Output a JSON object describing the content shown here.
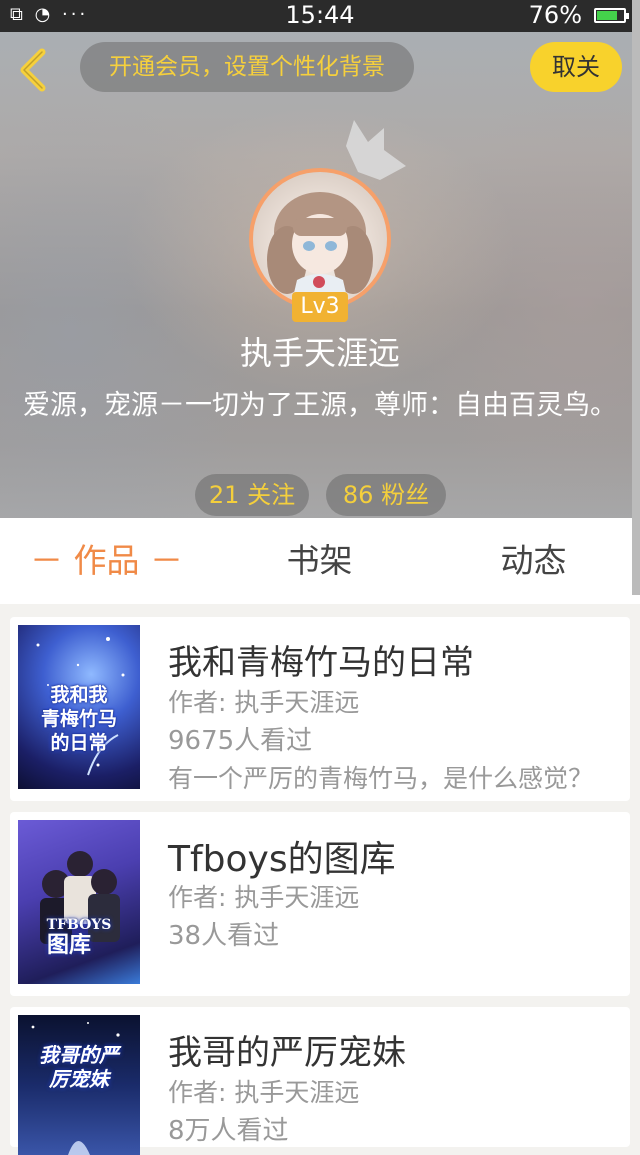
{
  "status_bar": {
    "left_icons": "⧉ ◔ ···",
    "time": "15:44",
    "battery": "76%",
    "battery_level": 0.76
  },
  "header": {
    "vip_prompt": "开通会员，设置个性化背景",
    "close_label": "取关",
    "level": "Lv3",
    "nickname": "执手天涯远",
    "bio": "爱源，宠源－一切为了王源，尊师：自由百灵鸟。",
    "following": "21 关注",
    "fans": "86 粉丝"
  },
  "tabs": [
    {
      "label": "－ 作品 －",
      "active": true
    },
    {
      "label": "书架",
      "active": false
    },
    {
      "label": "动态",
      "active": false
    }
  ],
  "books": [
    {
      "title": "我和青梅竹马的日常",
      "author": "作者: 执手天涯远",
      "views": "9675人看过",
      "desc": "有一个严厉的青梅竹马，是什么感觉？"
    },
    {
      "title": "Tfboys的图库",
      "author": "作者: 执手天涯远",
      "views": "38人看过",
      "desc": ""
    },
    {
      "title": "我哥的严厉宠妹",
      "author": "作者: 执手天涯远",
      "views": "8万人看过",
      "desc": ""
    }
  ],
  "colors": {
    "accent_orange": "#f08a47",
    "accent_yellow": "#f8d22c",
    "level_badge": "#f1b232"
  },
  "icons": [
    "back-chevron-icon",
    "crown-icon",
    "wifi-icon",
    "battery-icon"
  ]
}
